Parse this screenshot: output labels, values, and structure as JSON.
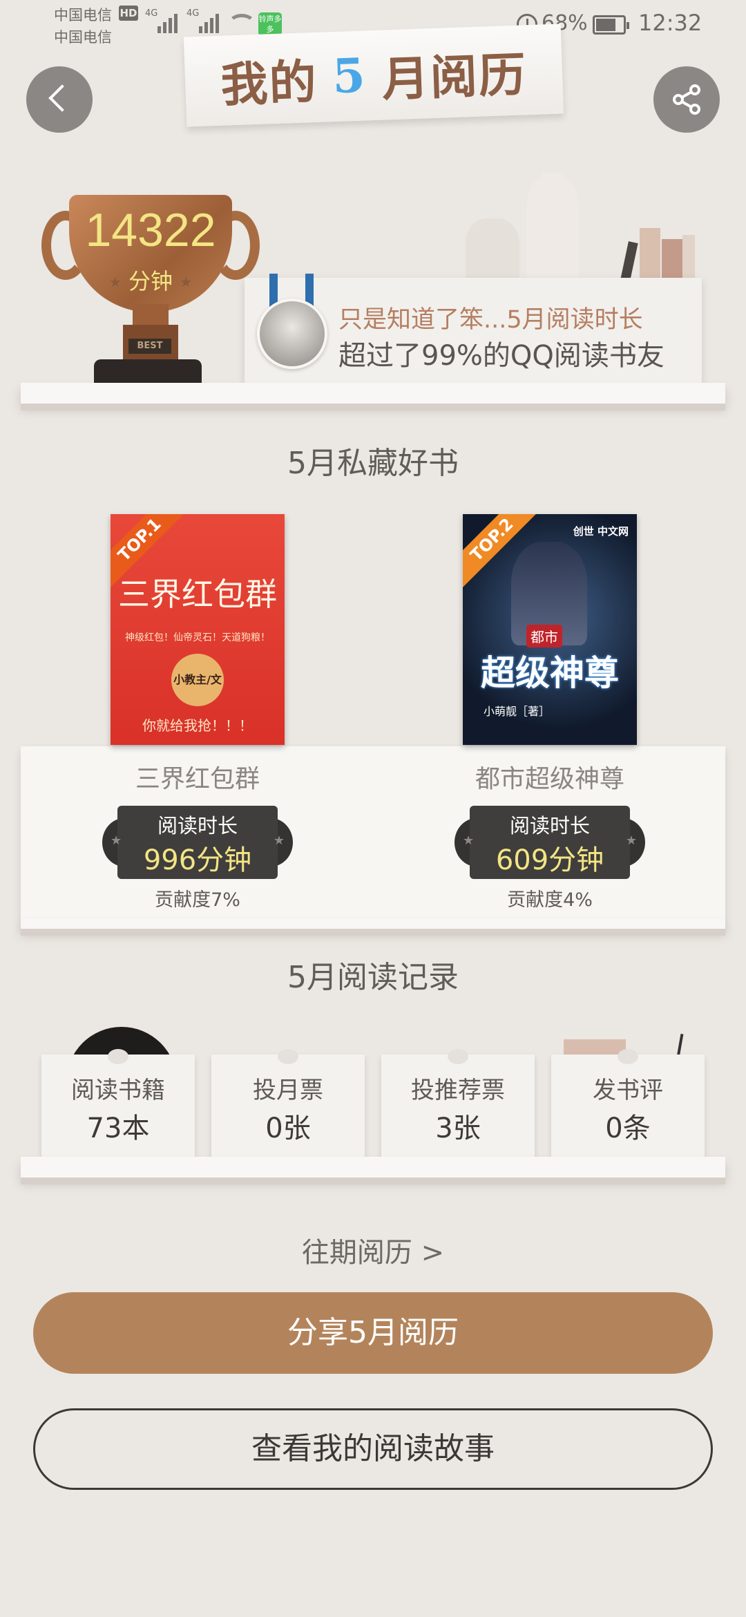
{
  "status_bar": {
    "carrier1": "中国电信",
    "carrier2": "中国电信",
    "hd": "HD",
    "net1": "4G",
    "net2": "4G",
    "app_badge": "铃声多多",
    "battery": "68%",
    "time": "12:32"
  },
  "header": {
    "title_prefix": "我的",
    "title_month": "5",
    "title_suffix": "月阅历"
  },
  "summary": {
    "minutes": "14322",
    "unit": "分钟",
    "trophy_label": "BEST",
    "rank_line1": "只是知道了笨...5月阅读时长",
    "rank_line2": "超过了99%的QQ阅读书友"
  },
  "favorites": {
    "section_title": "5月私藏好书",
    "books": [
      {
        "rank": "TOP.1",
        "cover_title": "三界红包群",
        "cover_tagline": "神级红包！仙帝灵石！天道狗粮！",
        "cover_author": "小教主/文",
        "cover_bottom": "你就给我抢！！！",
        "name": "三界红包群",
        "time_label": "阅读时长",
        "time_value": "996分钟",
        "contribution": "贡献度7%"
      },
      {
        "rank": "TOP.2",
        "cover_logo": "创世 中文网",
        "cover_small": "都市",
        "cover_title": "超级神尊",
        "cover_author": "小萌靓［著］",
        "name": "都市超级神尊",
        "time_label": "阅读时长",
        "time_value": "609分钟",
        "contribution": "贡献度4%"
      }
    ]
  },
  "records": {
    "section_title": "5月阅读记录",
    "items": [
      {
        "label": "阅读书籍",
        "value": "73本"
      },
      {
        "label": "投月票",
        "value": "0张"
      },
      {
        "label": "投推荐票",
        "value": "3张"
      },
      {
        "label": "发书评",
        "value": "0条"
      }
    ]
  },
  "actions": {
    "history_link": "往期阅历 >",
    "share_button": "分享5月阅历",
    "story_button": "查看我的阅读故事"
  },
  "colors": {
    "background": "#ebe7e3",
    "accent": "#b3845b",
    "gold": "#f3e584",
    "month_blue": "#4aa7e6"
  }
}
